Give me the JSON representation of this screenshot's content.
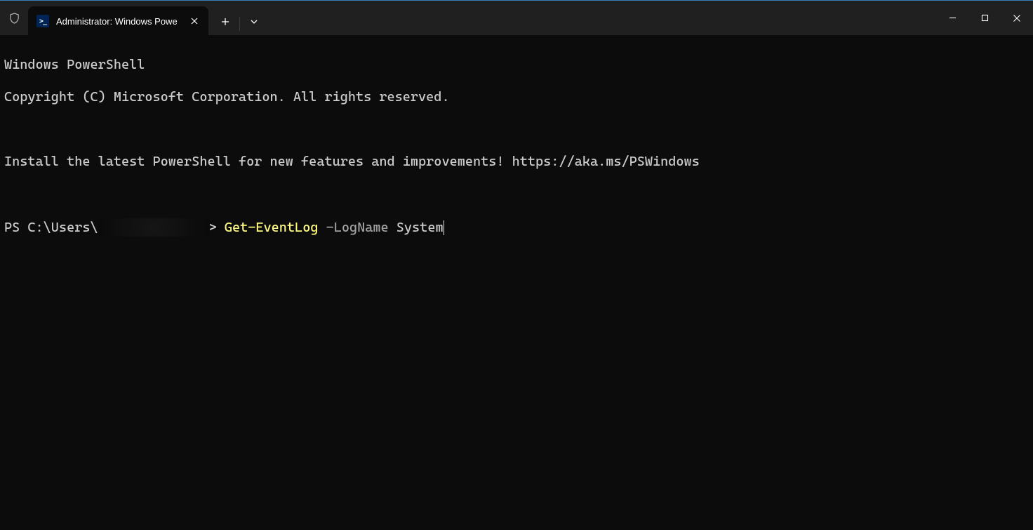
{
  "titlebar": {
    "tab": {
      "title": "Administrator: Windows Powe",
      "icon_label": ">_"
    }
  },
  "terminal": {
    "line1": "Windows PowerShell",
    "line2": "Copyright (C) Microsoft Corporation. All rights reserved.",
    "line3": "Install the latest PowerShell for new features and improvements! https://aka.ms/PSWindows",
    "prompt_prefix": "PS C:\\Users\\",
    "prompt_suffix": "> ",
    "command_cmdlet": "Get-EventLog",
    "command_param": " -LogName ",
    "command_arg": "System"
  }
}
